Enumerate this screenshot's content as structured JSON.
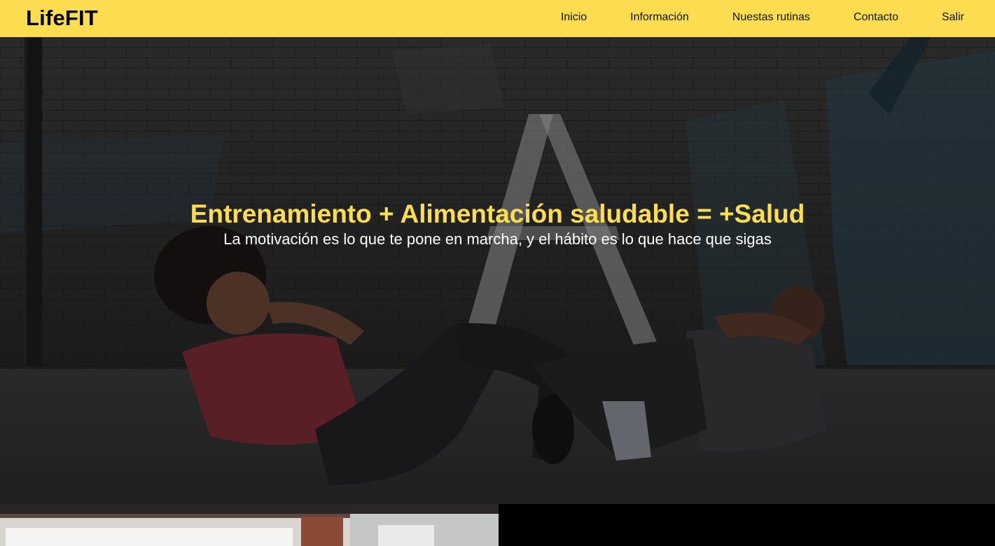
{
  "header": {
    "brand": "LifeFIT",
    "nav": [
      {
        "label": "Inicio"
      },
      {
        "label": "Información"
      },
      {
        "label": "Nuestas rutinas"
      },
      {
        "label": "Contacto"
      },
      {
        "label": "Salir"
      }
    ]
  },
  "hero": {
    "title": "Entrenamiento + Alimentación saludable = +Salud",
    "subtitle": "La motivación es lo que te pone en marcha, y el hábito es lo que hace que sigas"
  },
  "colors": {
    "accent": "#fcdd4f",
    "text_dark": "#111111",
    "hero_overlay": "#000000"
  }
}
